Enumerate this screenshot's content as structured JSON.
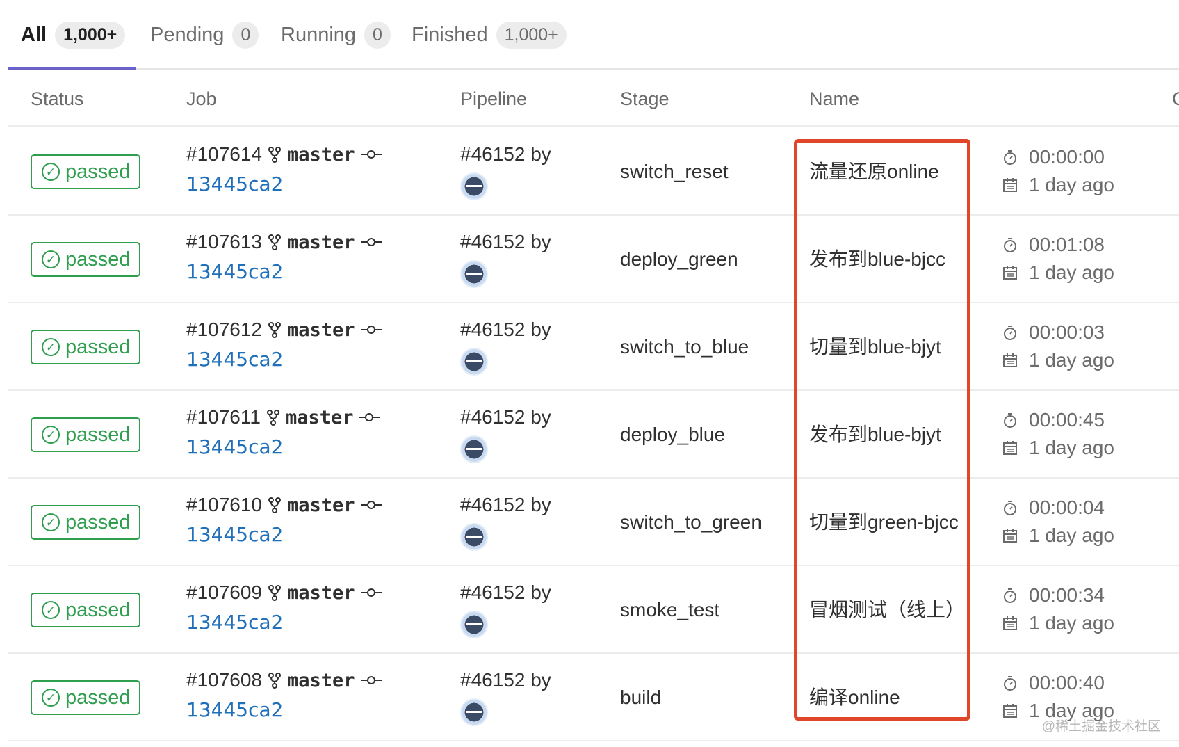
{
  "tabs": [
    {
      "label": "All",
      "count": "1,000+"
    },
    {
      "label": "Pending",
      "count": "0"
    },
    {
      "label": "Running",
      "count": "0"
    },
    {
      "label": "Finished",
      "count": "1,000+"
    }
  ],
  "columns": {
    "status": "Status",
    "job": "Job",
    "pipeline": "Pipeline",
    "stage": "Stage",
    "name": "Name",
    "cut": "C"
  },
  "rows": [
    {
      "status": "passed",
      "job_id": "#107614",
      "branch": "master",
      "sha": "13445ca2",
      "pipeline": "#46152 by",
      "stage": "switch_reset",
      "name": "流量还原online",
      "duration": "00:00:00",
      "finished": "1 day ago"
    },
    {
      "status": "passed",
      "job_id": "#107613",
      "branch": "master",
      "sha": "13445ca2",
      "pipeline": "#46152 by",
      "stage": "deploy_green",
      "name": "发布到blue-bjcc",
      "duration": "00:01:08",
      "finished": "1 day ago"
    },
    {
      "status": "passed",
      "job_id": "#107612",
      "branch": "master",
      "sha": "13445ca2",
      "pipeline": "#46152 by",
      "stage": "switch_to_blue",
      "name": "切量到blue-bjyt",
      "duration": "00:00:03",
      "finished": "1 day ago"
    },
    {
      "status": "passed",
      "job_id": "#107611",
      "branch": "master",
      "sha": "13445ca2",
      "pipeline": "#46152 by",
      "stage": "deploy_blue",
      "name": "发布到blue-bjyt",
      "duration": "00:00:45",
      "finished": "1 day ago"
    },
    {
      "status": "passed",
      "job_id": "#107610",
      "branch": "master",
      "sha": "13445ca2",
      "pipeline": "#46152 by",
      "stage": "switch_to_green",
      "name": "切量到green-bjcc",
      "duration": "00:00:04",
      "finished": "1 day ago"
    },
    {
      "status": "passed",
      "job_id": "#107609",
      "branch": "master",
      "sha": "13445ca2",
      "pipeline": "#46152 by",
      "stage": "smoke_test",
      "name": "冒烟测试（线上）",
      "duration": "00:00:34",
      "finished": "1 day ago"
    },
    {
      "status": "passed",
      "job_id": "#107608",
      "branch": "master",
      "sha": "13445ca2",
      "pipeline": "#46152 by",
      "stage": "build",
      "name": "编译online",
      "duration": "00:00:40",
      "finished": "1 day ago"
    }
  ],
  "watermark": "@稀土掘金技术社区",
  "colors": {
    "passed": "#2f9e4e",
    "link": "#1f6fba",
    "active_tab": "#6a61c9",
    "highlight": "#e0472a"
  }
}
